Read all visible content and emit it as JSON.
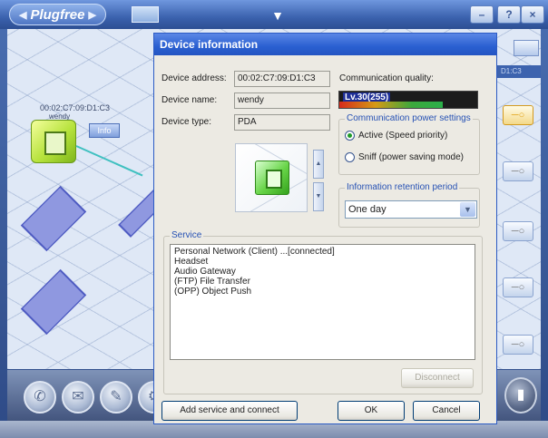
{
  "app": {
    "title": "Plugfree",
    "window_buttons": {
      "minimize": "–",
      "help": "?",
      "close": "×"
    }
  },
  "workspace": {
    "device_mac": "00:02:C7:09:D1:C3",
    "device_name": "wendy",
    "info_button": "Info",
    "right_strip_text": "D1:C3",
    "key_glyph": "─○"
  },
  "dialog": {
    "title": "Device information",
    "fields": {
      "address_label": "Device address:",
      "address_value": "00:02:C7:09:D1:C3",
      "name_label": "Device name:",
      "name_value": "wendy",
      "type_label": "Device type:",
      "type_value": "PDA"
    },
    "quality": {
      "label": "Communication quality:",
      "value_text": "Lv.30(255)",
      "level": 30,
      "max": 255
    },
    "power": {
      "legend": "Communication power settings",
      "options": [
        {
          "label": "Active (Speed priority)",
          "selected": true
        },
        {
          "label": "Sniff (power saving mode)",
          "selected": false
        }
      ]
    },
    "retention": {
      "legend": "Information retention period",
      "selected": "One day"
    },
    "service": {
      "legend": "Service",
      "items": [
        "Personal Network (Client) ...[connected]",
        "Headset",
        "Audio Gateway",
        "(FTP) File Transfer",
        "(OPP) Object Push"
      ]
    },
    "buttons": {
      "disconnect": "Disconnect",
      "add_service": "Add service and connect",
      "ok": "OK",
      "cancel": "Cancel"
    }
  },
  "colors": {
    "title_blue": "#2a5fd1",
    "accent_green": "#67d447",
    "diamond_purple": "#8f98e0"
  }
}
